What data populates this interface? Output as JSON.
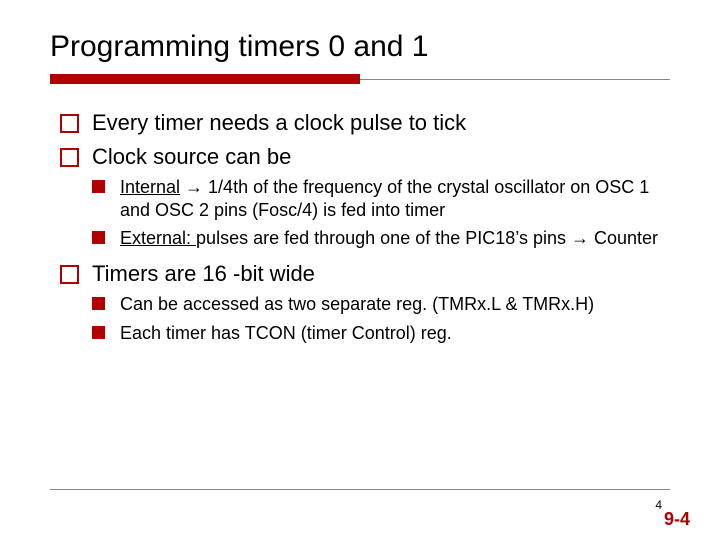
{
  "title": "Programming timers 0 and 1",
  "bullets": {
    "b1": "Every timer needs a clock pulse to tick",
    "b2": "Clock source can be",
    "b2_1_label": "Internal",
    "b2_1_rest": " → 1/4th of the frequency of the crystal oscillator on OSC 1 and OSC 2 pins (Fosc/4) is fed into timer",
    "b2_2_label": "External: ",
    "b2_2_rest": "pulses are fed through one of the PIC18’s pins → Counter",
    "b3": "Timers are 16 -bit wide",
    "b3_1": "Can be accessed as two separate reg. (TMRx.L & TMRx.H)",
    "b3_2": "Each timer has TCON (timer Control) reg."
  },
  "footer": {
    "page_small": "4",
    "page_large": "9-4"
  }
}
